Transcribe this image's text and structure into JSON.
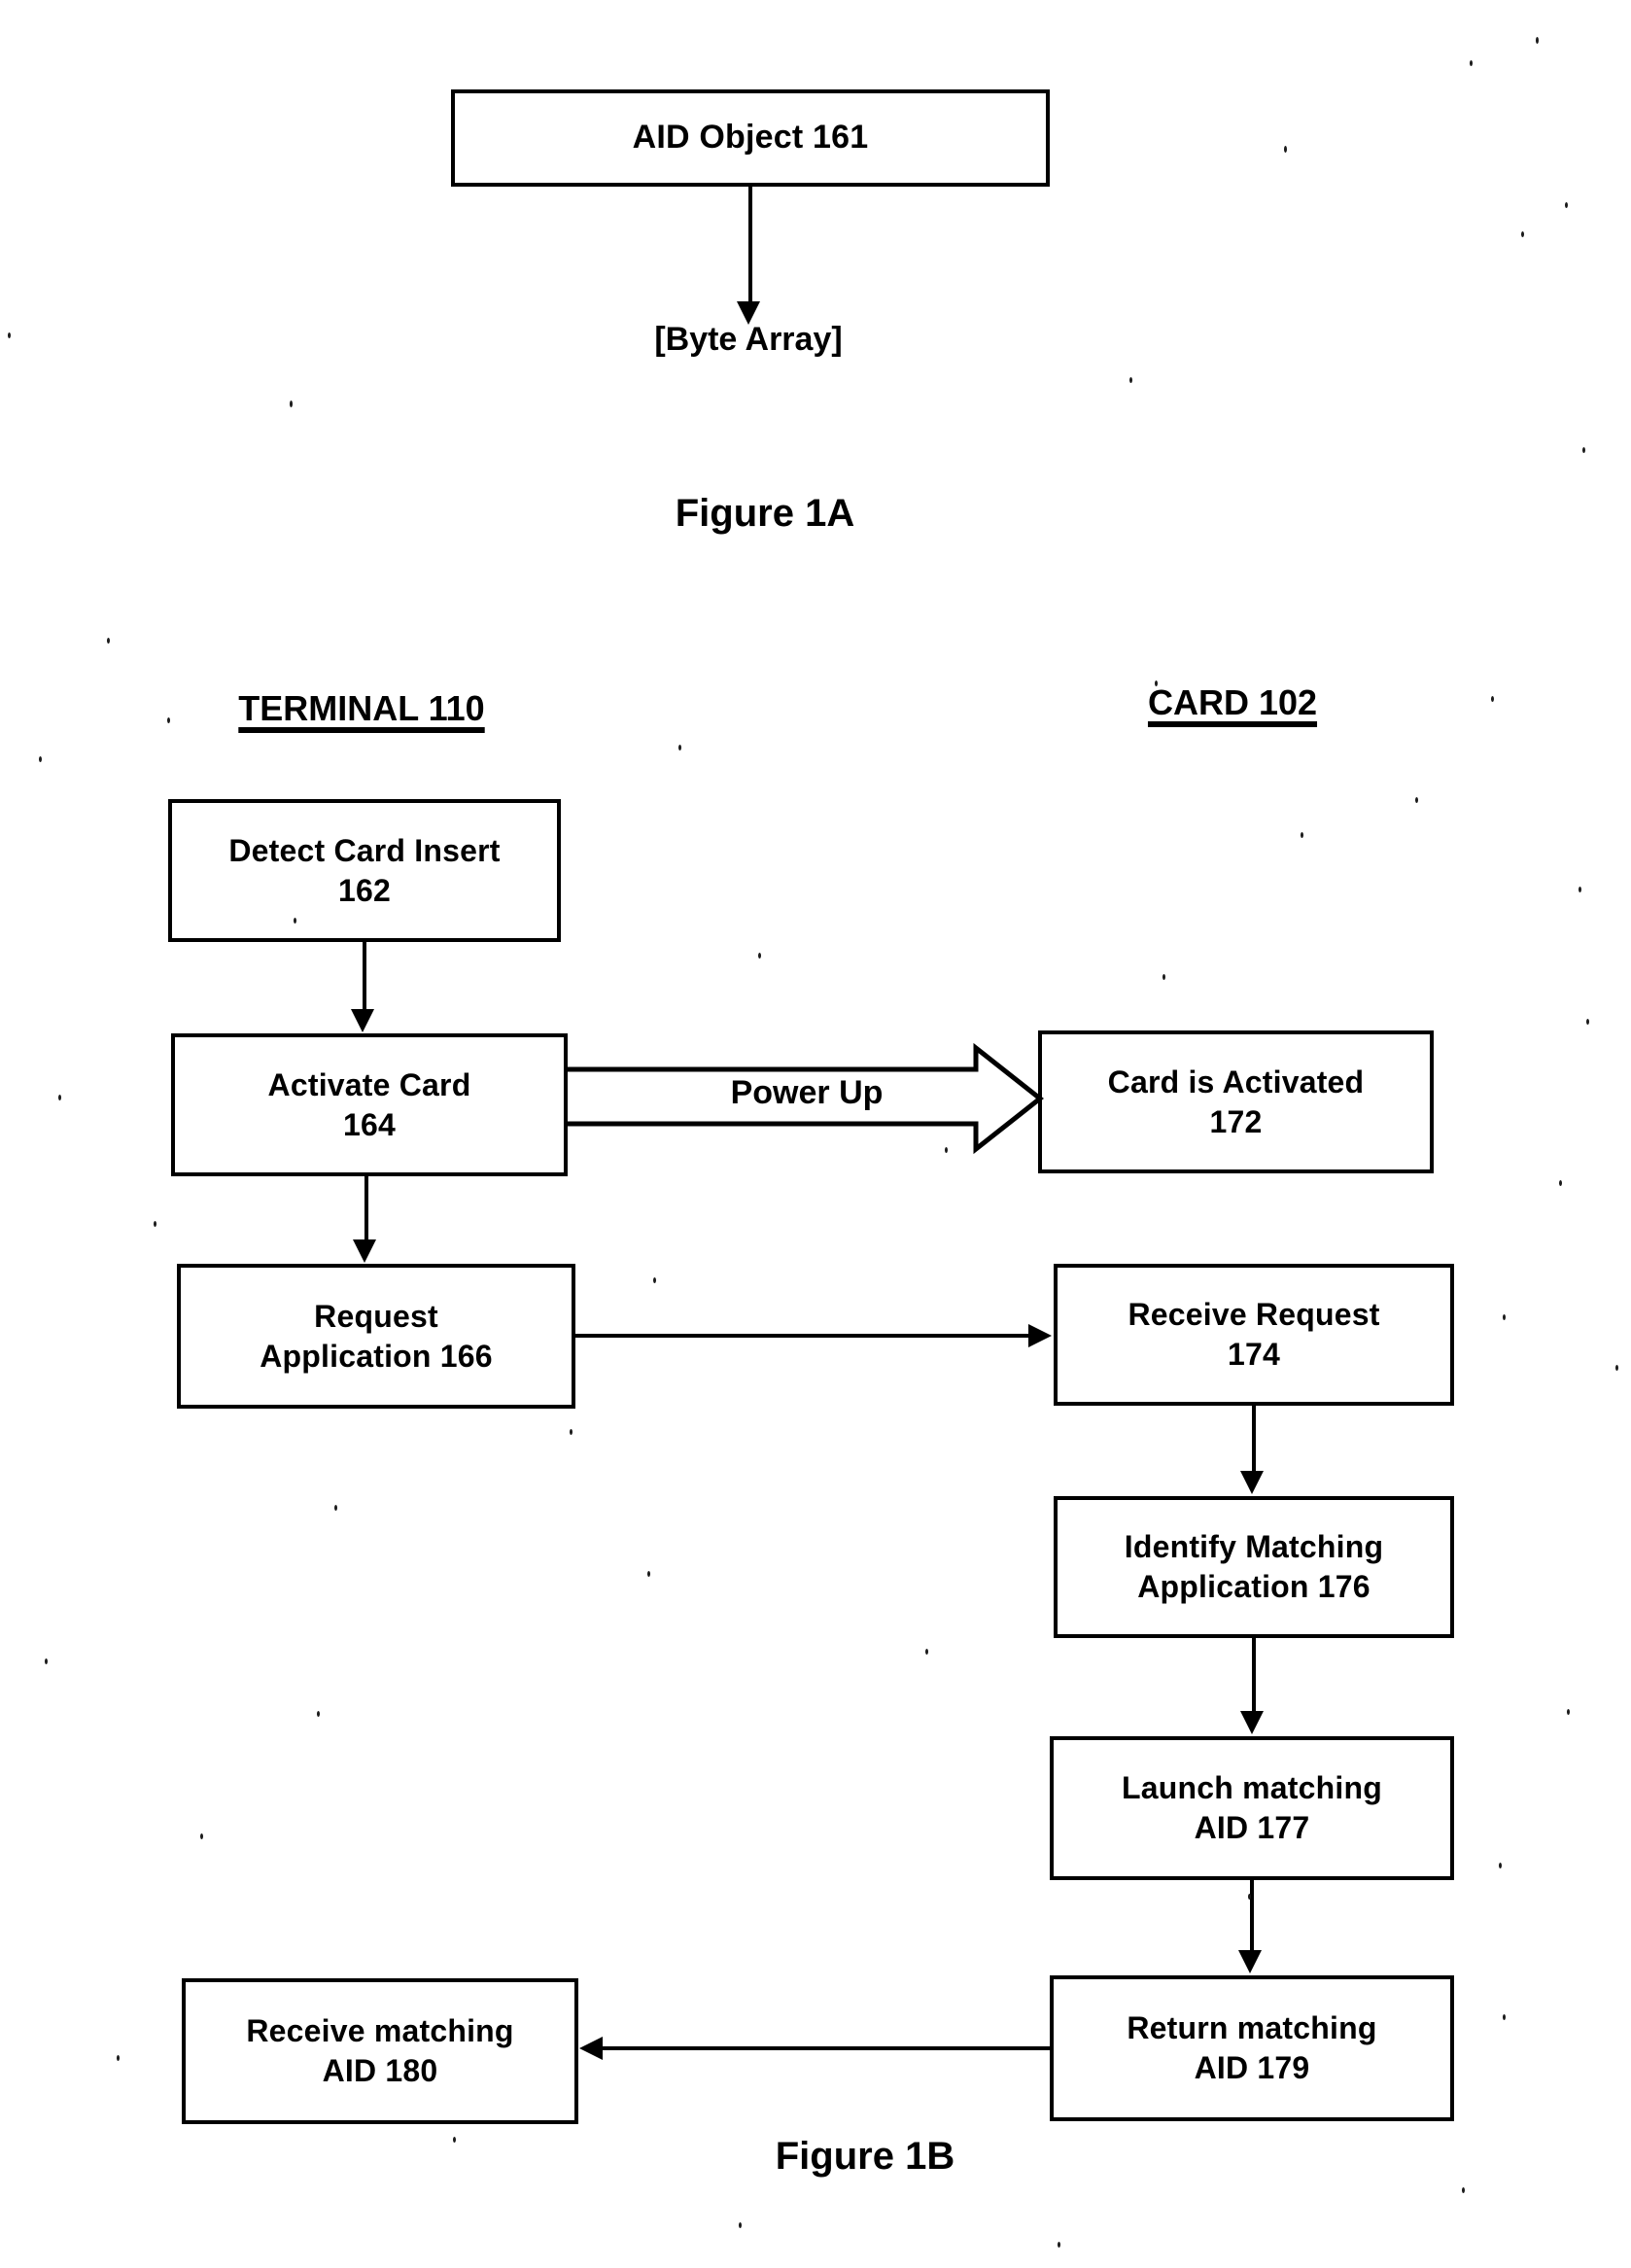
{
  "document": {
    "type": "patent-flow-diagram",
    "background_color": "#ffffff",
    "ink_color": "#000000"
  },
  "figure_1a": {
    "caption": "Figure 1A",
    "node": {
      "label": "AID Object 161"
    },
    "arrow_label": "[Byte Array]"
  },
  "figure_1b": {
    "caption": "Figure 1B",
    "columns": [
      {
        "id": "terminal",
        "heading": "TERMINAL 110"
      },
      {
        "id": "card",
        "heading": "CARD 102"
      }
    ],
    "nodes": [
      {
        "id": "n162",
        "column": "terminal",
        "line1": "Detect Card Insert",
        "line2": "162"
      },
      {
        "id": "n164",
        "column": "terminal",
        "line1": "Activate Card",
        "line2": "164"
      },
      {
        "id": "n166",
        "column": "terminal",
        "line1": "Request",
        "line2": "Application 166"
      },
      {
        "id": "n180",
        "column": "terminal",
        "line1": "Receive matching",
        "line2": "AID 180"
      },
      {
        "id": "n172",
        "column": "card",
        "line1": "Card is Activated",
        "line2": "172"
      },
      {
        "id": "n174",
        "column": "card",
        "line1": "Receive Request",
        "line2": "174"
      },
      {
        "id": "n176",
        "column": "card",
        "line1": "Identify Matching",
        "line2": "Application 176"
      },
      {
        "id": "n177",
        "column": "card",
        "line1": "Launch matching",
        "line2": "AID 177"
      },
      {
        "id": "n179",
        "column": "card",
        "line1": "Return matching",
        "line2": "AID 179"
      }
    ],
    "edges": [
      {
        "from": "n162",
        "to": "n164",
        "label": ""
      },
      {
        "from": "n164",
        "to": "n172",
        "label": "Power Up"
      },
      {
        "from": "n164",
        "to": "n166",
        "label": ""
      },
      {
        "from": "n166",
        "to": "n174",
        "label": ""
      },
      {
        "from": "n174",
        "to": "n176",
        "label": ""
      },
      {
        "from": "n176",
        "to": "n177",
        "label": ""
      },
      {
        "from": "n177",
        "to": "n179",
        "label": ""
      },
      {
        "from": "n179",
        "to": "n180",
        "label": ""
      }
    ],
    "power_up_label": "Power Up"
  }
}
